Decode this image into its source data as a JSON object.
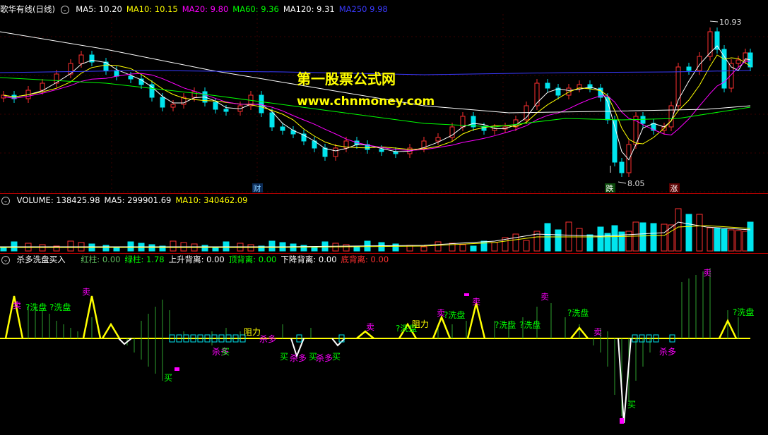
{
  "main_panel": {
    "title": "歌华有线(日线)",
    "ma_legend": [
      {
        "label": "MA5: 10.20",
        "color": "#ffffff"
      },
      {
        "label": "MA10: 10.15",
        "color": "#ffff00"
      },
      {
        "label": "MA20: 9.80",
        "color": "#ff00ff"
      },
      {
        "label": "MA60: 9.36",
        "color": "#00ff00"
      },
      {
        "label": "MA120: 9.31",
        "color": "#ffffff"
      },
      {
        "label": "MA250  9.98",
        "color": "#3a3aff"
      }
    ],
    "high_label": "10.93",
    "low_label": "8.05",
    "event_tags": {
      "cai": "财",
      "die": "跌",
      "zhang": "涨"
    },
    "watermark_cn": "第一股票公式网",
    "watermark_url": "www.chnmoney.com"
  },
  "volume_panel": {
    "legend": [
      {
        "label": "VOLUME: 138425.98",
        "color": "#ffffff"
      },
      {
        "label": "MA5: 299901.69",
        "color": "#ffffff"
      },
      {
        "label": "MA10: 340462.09",
        "color": "#ffff00"
      }
    ]
  },
  "indicator_panel": {
    "title": "杀多洗盘买入",
    "legend": [
      {
        "label": "红柱: 0.00",
        "color": "#5fbf5f"
      },
      {
        "label": "绿柱: 1.78",
        "color": "#00ff00"
      },
      {
        "label": "上升背离: 0.00",
        "color": "#ffffff"
      },
      {
        "label": "顶背离: 0.00",
        "color": "#00ff00"
      },
      {
        "label": "下降背离: 0.00",
        "color": "#ffffff"
      },
      {
        "label": "底背离: 0.00",
        "color": "#ff3030"
      }
    ],
    "signals": {
      "sell": "卖",
      "buy": "买",
      "wash": "?洗盘",
      "resist": "阻力",
      "kill": "杀多"
    }
  }
}
